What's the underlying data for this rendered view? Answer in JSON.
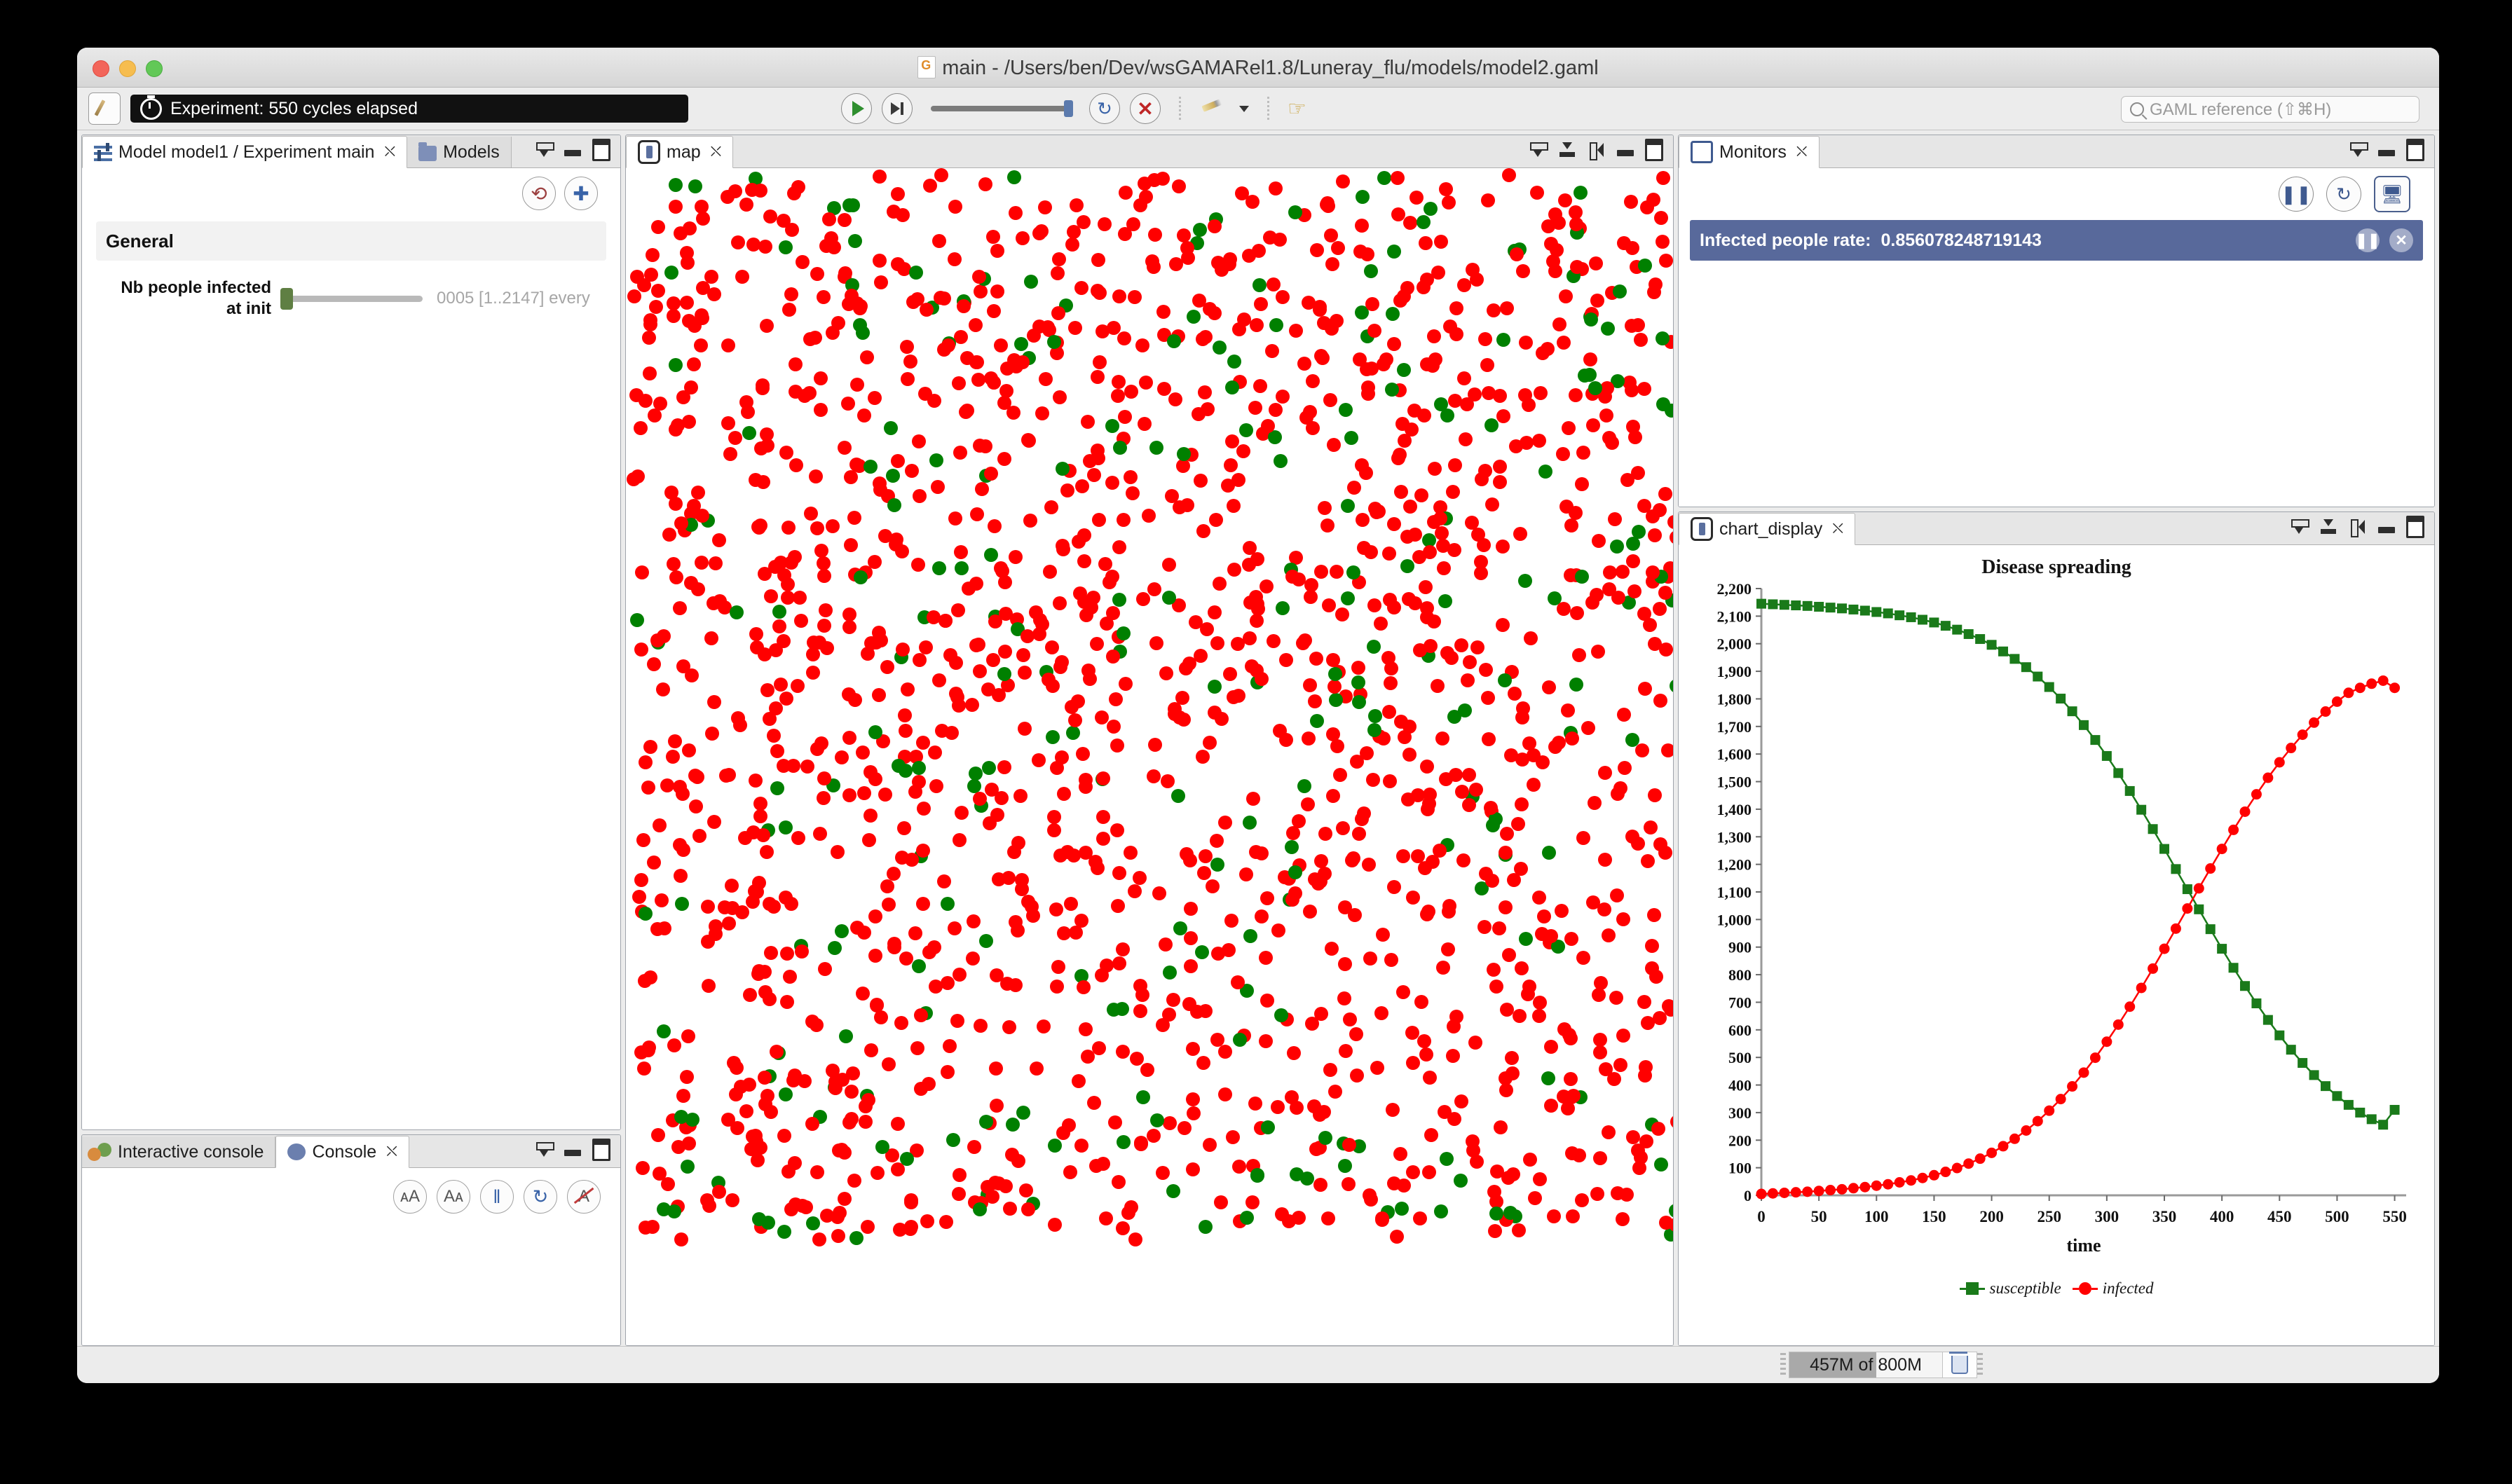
{
  "window": {
    "title": "main - /Users/ben/Dev/wsGAMARel1.8/Luneray_flu/models/model2.gaml",
    "doc_icon": "gaml-file-icon"
  },
  "toolbar": {
    "editor_icon": "edit-pencil-icon",
    "experiment_badge": "Experiment: 550 cycles elapsed",
    "clock_icon": "stopwatch-icon",
    "run_icon": "play-icon",
    "step_icon": "step-forward-icon",
    "speed_slider_label": "simulation-speed-slider",
    "reload_icon": "reload-icon",
    "stop_icon": "stop-close-icon",
    "pen_icon": "pen-tool-icon",
    "caret_icon": "chevron-down-icon",
    "hand_icon": "pointer-hand-icon",
    "search_placeholder": "GAML reference (⇧⌘H)",
    "search_icon": "search-icon"
  },
  "params_panel": {
    "tabs": [
      {
        "label": "Model model1 / Experiment main",
        "icon": "parameters-icon",
        "active": true,
        "closable": true
      },
      {
        "label": "Models",
        "icon": "folder-icon",
        "active": false,
        "closable": false
      }
    ],
    "view_buttons": [
      "minimize-icon",
      "maximize-icon",
      "restore-icon"
    ],
    "revert_icon": "revert-arrow-icon",
    "add_icon": "plus-icon",
    "group_title": "General",
    "parameter": {
      "label_line1": "Nb people infected",
      "label_line2": "at init",
      "value_text": "0005 [1..2147] every "
    }
  },
  "console_panel": {
    "tabs": [
      {
        "label": "Interactive console",
        "icon": "chat-bubbles-icon",
        "active": false,
        "closable": false
      },
      {
        "label": "Console",
        "icon": "chat-bubble-icon",
        "active": true,
        "closable": true
      }
    ],
    "view_buttons": [
      "minimize-icon",
      "maximize-icon",
      "restore-icon"
    ],
    "buttons": [
      {
        "icon": "increase-font-icon",
        "label": "ᴀA"
      },
      {
        "icon": "decrease-font-icon",
        "label": "Aᴀ"
      },
      {
        "icon": "pause-icon",
        "label": "‖"
      },
      {
        "icon": "refresh-icon",
        "label": "↻"
      },
      {
        "icon": "clear-text-icon",
        "label": "A"
      }
    ]
  },
  "map_panel": {
    "tab": {
      "label": "map",
      "icon": "display-icon",
      "closable": true
    },
    "view_buttons": [
      "collapse-icon",
      "expand-icon",
      "sync-icon",
      "minimize-icon",
      "maximize-icon"
    ],
    "agent_colors": {
      "infected": "#FF0000",
      "susceptible": "#008000"
    },
    "counts": {
      "infected": 1840,
      "susceptible": 310
    }
  },
  "monitors_panel": {
    "tab": {
      "label": "Monitors",
      "icon": "monitor-icon",
      "closable": true
    },
    "view_buttons": [
      "minimize-icon",
      "maximize-icon",
      "restore-icon"
    ],
    "buttons": [
      "pause-icon",
      "refresh-icon",
      "new-monitor-icon"
    ],
    "rows": [
      {
        "label": "Infected people rate:",
        "value": "0.856078248719143",
        "pause_icon": "pause-icon",
        "close_icon": "close-icon"
      }
    ]
  },
  "chart_panel": {
    "tab": {
      "label": "chart_display",
      "icon": "display-icon",
      "closable": true
    },
    "view_buttons": [
      "collapse-icon",
      "expand-icon",
      "sync-icon",
      "minimize-icon",
      "maximize-icon"
    ]
  },
  "status_bar": {
    "memory_used": "457M",
    "memory_of": "of",
    "memory_total": "800M",
    "memory_text": "457M of 800M",
    "memory_percent": 57,
    "trash_icon": "trash-icon"
  },
  "chart_data": {
    "type": "line",
    "title": "Disease spreading",
    "xlabel": "time",
    "ylabel": "",
    "xlim": [
      0,
      560
    ],
    "ylim": [
      0,
      2200
    ],
    "xticks": [
      0,
      50,
      100,
      150,
      200,
      250,
      300,
      350,
      400,
      450,
      500,
      550
    ],
    "yticks": [
      0,
      100,
      200,
      300,
      400,
      500,
      600,
      700,
      800,
      900,
      1000,
      1100,
      1200,
      1300,
      1400,
      1500,
      1600,
      1700,
      1800,
      1900,
      2000,
      2100,
      2200
    ],
    "grid": false,
    "legend_position": "bottom",
    "x": [
      0,
      10,
      20,
      30,
      40,
      50,
      60,
      70,
      80,
      90,
      100,
      110,
      120,
      130,
      140,
      150,
      160,
      170,
      180,
      190,
      200,
      210,
      220,
      230,
      240,
      250,
      260,
      270,
      280,
      290,
      300,
      310,
      320,
      330,
      340,
      350,
      360,
      370,
      380,
      390,
      400,
      410,
      420,
      430,
      440,
      450,
      460,
      470,
      480,
      490,
      500,
      510,
      520,
      530,
      540,
      550
    ],
    "series": [
      {
        "name": "susceptible",
        "color": "#1a7a1a",
        "marker": "square",
        "values": [
          2145,
          2143,
          2141,
          2139,
          2137,
          2134,
          2131,
          2128,
          2124,
          2120,
          2115,
          2110,
          2103,
          2096,
          2087,
          2077,
          2065,
          2051,
          2035,
          2017,
          1996,
          1972,
          1945,
          1915,
          1881,
          1843,
          1801,
          1755,
          1705,
          1651,
          1593,
          1531,
          1466,
          1398,
          1328,
          1256,
          1183,
          1110,
          1037,
          965,
          894,
          825,
          759,
          696,
          636,
          580,
          528,
          480,
          436,
          396,
          360,
          328,
          300,
          276,
          256,
          310
        ]
      },
      {
        "name": "infected",
        "color": "#ff0000",
        "marker": "circle",
        "values": [
          5,
          7,
          9,
          11,
          13,
          16,
          19,
          22,
          26,
          30,
          35,
          40,
          47,
          54,
          63,
          73,
          85,
          99,
          115,
          133,
          154,
          178,
          205,
          235,
          269,
          307,
          349,
          395,
          445,
          499,
          557,
          619,
          684,
          752,
          822,
          894,
          967,
          1040,
          1113,
          1185,
          1256,
          1325,
          1391,
          1454,
          1514,
          1570,
          1622,
          1670,
          1714,
          1754,
          1790,
          1822,
          1840,
          1855,
          1866,
          1840
        ]
      }
    ]
  }
}
